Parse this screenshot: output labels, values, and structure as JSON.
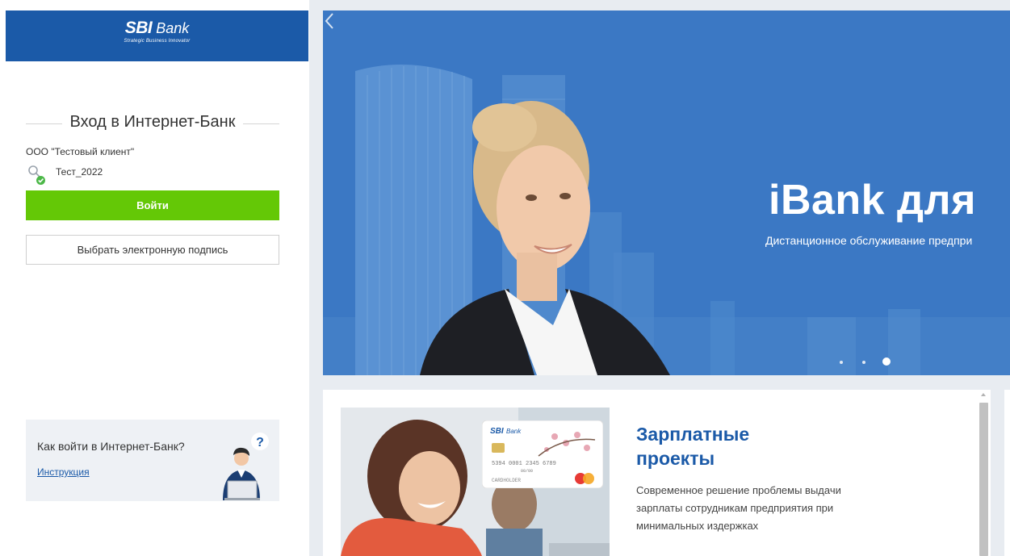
{
  "logo": {
    "brand": "SBI",
    "name": "Bank",
    "tagline": "Strategic Business Innovator"
  },
  "login": {
    "title": "Вход в Интернет-Банк",
    "company": "ООО \"Тестовый клиент\"",
    "key_name": "Тест_2022",
    "login_button": "Войти",
    "sign_button": "Выбрать электронную подпись"
  },
  "help": {
    "question": "Как войти в Интернет-Банк?",
    "link": "Инструкция"
  },
  "hero": {
    "title": "iBank для",
    "subtitle": "Дистанционное обслуживание предпри",
    "slide_count": 3,
    "active_slide": 3
  },
  "promo": {
    "title_line1": "Зарплатные",
    "title_line2": "проекты",
    "text": "Современное решение проблемы выдачи зарплаты сотрудникам предприятия при минимальных издержках"
  },
  "card_graphic": {
    "brand": "SBI",
    "name": "Bank",
    "number": "5394 0001 2345 6789",
    "valid": "00/00",
    "holder": "CARDHOLDER"
  },
  "colors": {
    "brand_blue": "#1b5aa8",
    "login_green": "#64c806",
    "hero_blue": "#3a76c2"
  }
}
